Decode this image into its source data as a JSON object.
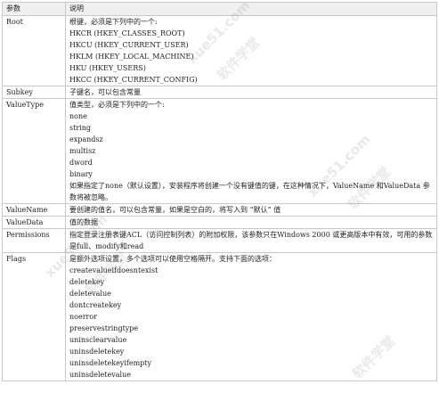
{
  "table": {
    "header": {
      "param": "参数",
      "desc": "说明"
    },
    "rows": [
      {
        "param": "Root",
        "lines": [
          "根键，必须是下列中的一个:",
          "HKCR (HKEY_CLASSES_ROOT)",
          "HKCU (HKEY_CURRENT_USER)",
          "HKLM (HKEY_LOCAL_MACHINE)",
          "HKU (HKEY_USERS)",
          "HKCC (HKEY_CURRENT_CONFIG)"
        ]
      },
      {
        "param": "Subkey",
        "lines": [
          "子键名，可以包含常量"
        ]
      },
      {
        "param": "ValueType",
        "lines": [
          "值类型，必须是下列中的一个:",
          "none",
          "string",
          "expandsz",
          "multisz",
          "dword",
          "binary"
        ],
        "note": "如果指定了none（默认设置），安装程序将创建一个没有键值的键，在这种情况下，ValueName 和ValueData 参数将被忽略。"
      },
      {
        "param": "ValueName",
        "lines": [
          "要创建的值名，可以包含常量，如果是空白的，将写入到 “默认” 值"
        ]
      },
      {
        "param": "ValueData",
        "lines": [
          "值的数据"
        ]
      },
      {
        "param": "Permissions",
        "note": "指定登录注册表键ACL（访问控制列表）的附加权限，该参数只在Windows 2000 或更高版本中有效，可用的参数是full、modify和read"
      },
      {
        "param": "Flags",
        "lines": [
          "是额外选项设置，多个选项可以使用空格隔开。支持下面的选项：",
          "createvalueifdoesntexist",
          "deletekey",
          "deletevalue",
          "dontcreatekey",
          "noerror",
          "preservestringtype",
          "uninsclearvalue",
          "uninsdeletekey",
          "uninsdeletekeyifempty",
          "uninsdeletevalue"
        ]
      }
    ]
  },
  "watermark": {
    "text": "软件学堂",
    "site": "xue51.com"
  }
}
